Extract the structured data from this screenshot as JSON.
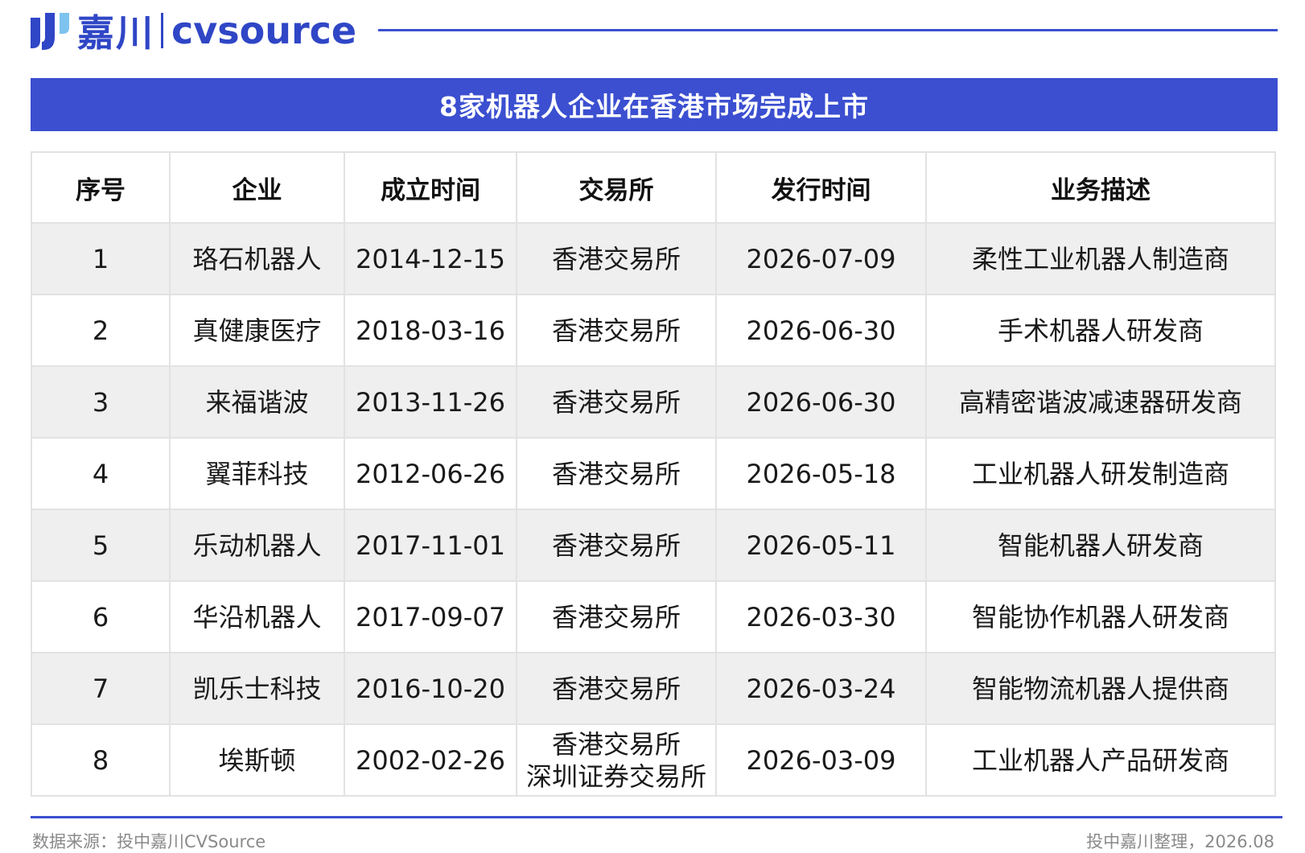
{
  "brand": {
    "logo_cn": "嘉川",
    "logo_en": "cvsource",
    "color": "#2f46c6"
  },
  "title": "8家机器人企业在香港市场完成上市",
  "table": {
    "headers": [
      "序号",
      "企业",
      "成立时间",
      "交易所",
      "发行时间",
      "业务描述"
    ],
    "rows": [
      {
        "no": "1",
        "company": "珞石机器人",
        "founded": "2014-12-15",
        "exchange": [
          "香港交易所"
        ],
        "issue": "2026-07-09",
        "desc": "柔性工业机器人制造商"
      },
      {
        "no": "2",
        "company": "真健康医疗",
        "founded": "2018-03-16",
        "exchange": [
          "香港交易所"
        ],
        "issue": "2026-06-30",
        "desc": "手术机器人研发商"
      },
      {
        "no": "3",
        "company": "来福谐波",
        "founded": "2013-11-26",
        "exchange": [
          "香港交易所"
        ],
        "issue": "2026-06-30",
        "desc": "高精密谐波减速器研发商"
      },
      {
        "no": "4",
        "company": "翼菲科技",
        "founded": "2012-06-26",
        "exchange": [
          "香港交易所"
        ],
        "issue": "2026-05-18",
        "desc": "工业机器人研发制造商"
      },
      {
        "no": "5",
        "company": "乐动机器人",
        "founded": "2017-11-01",
        "exchange": [
          "香港交易所"
        ],
        "issue": "2026-05-11",
        "desc": "智能机器人研发商"
      },
      {
        "no": "6",
        "company": "华沿机器人",
        "founded": "2017-09-07",
        "exchange": [
          "香港交易所"
        ],
        "issue": "2026-03-30",
        "desc": "智能协作机器人研发商"
      },
      {
        "no": "7",
        "company": "凯乐士科技",
        "founded": "2016-10-20",
        "exchange": [
          "香港交易所"
        ],
        "issue": "2026-03-24",
        "desc": "智能物流机器人提供商"
      },
      {
        "no": "8",
        "company": "埃斯顿",
        "founded": "2002-02-26",
        "exchange": [
          "香港交易所",
          "深圳证券交易所"
        ],
        "issue": "2026-03-09",
        "desc": "工业机器人产品研发商"
      }
    ]
  },
  "footer": {
    "source": "数据来源：投中嘉川CVSource",
    "credit": "投中嘉川整理，2026.08"
  },
  "colors": {
    "accent": "#3b4fd0",
    "row_shade": "#efefef"
  }
}
